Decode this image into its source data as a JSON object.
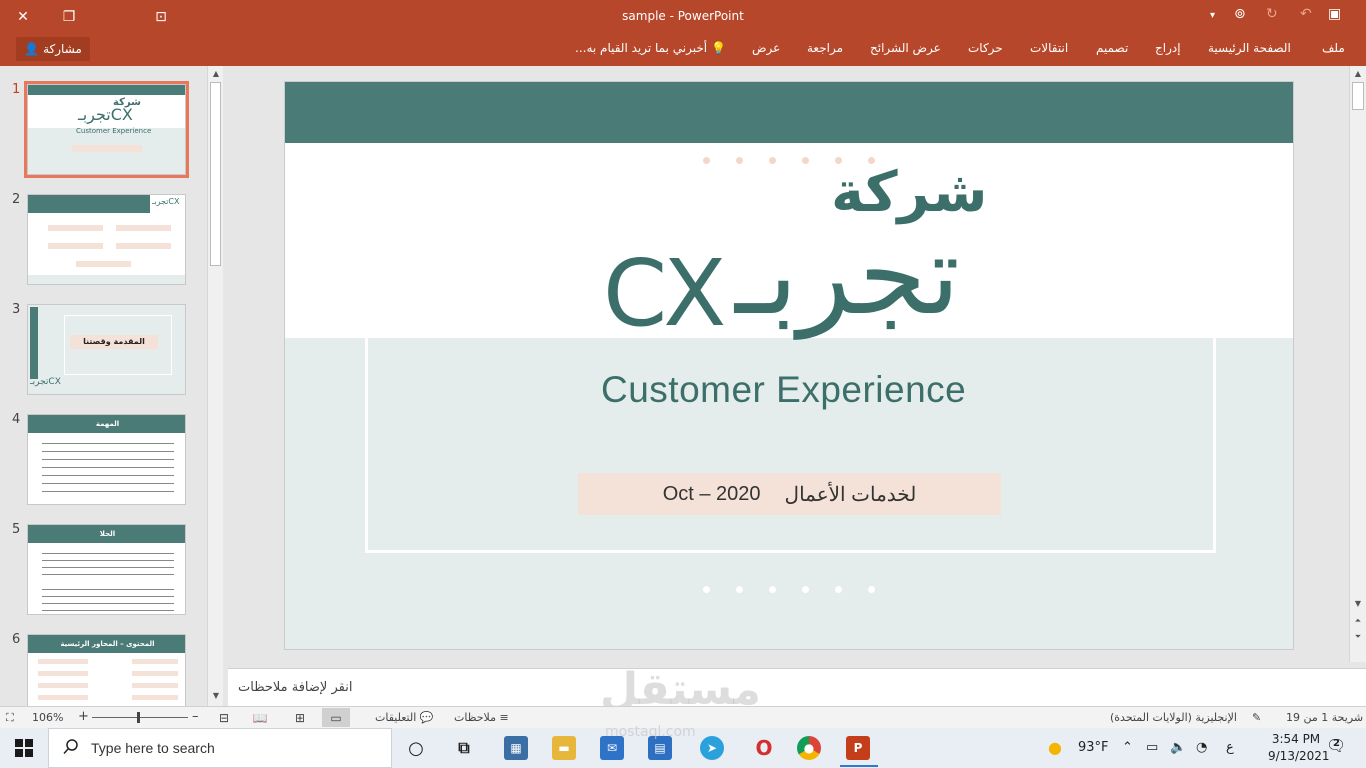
{
  "window": {
    "title": "sample - PowerPoint",
    "share_label": "مشاركة"
  },
  "ribbon": {
    "tabs": [
      "ملف",
      "الصفحة الرئيسية",
      "إدراج",
      "تصميم",
      "انتقالات",
      "حركات",
      "عرض الشرائح",
      "مراجعة",
      "عرض"
    ],
    "tell_me": "أخبرني بما تريد القيام به..."
  },
  "thumbnails": {
    "numbers": [
      "1",
      "2",
      "3",
      "4",
      "5",
      "6"
    ],
    "active_index": 1,
    "slide3_title": "المقدمة وقصتنا",
    "slide4_title": "المهمة",
    "slide5_title": "الحلا",
    "slide6_title": "المحتوى – المحاور الرئيسية",
    "slide2_logo": "تجربـCX"
  },
  "slide": {
    "company": "شركة",
    "brand_ar": "تجربـ",
    "brand_cx": "CX",
    "brand_en": "Customer Experience",
    "date_text": "Oct – 2020",
    "service_text": "لخدمات الأعمال",
    "colors": {
      "primary": "#4a7b76",
      "light_bg": "#e4ecec",
      "peach": "#f4e2d8",
      "dot_peach": "#f4d7c8"
    }
  },
  "notes": {
    "placeholder": "انقر لإضافة ملاحظات"
  },
  "watermark": {
    "text": "مستقل",
    "sub": "mostaql.com"
  },
  "statusbar": {
    "zoom": "106%",
    "comments_label": "التعليقات",
    "notes_label": "ملاحظات",
    "language": "الإنجليزية (الولايات المتحدة)",
    "slide_counter": "شريحة 1 من 19"
  },
  "taskbar": {
    "search_placeholder": "Type here to search",
    "weather": "93°F",
    "keyboard_lang": "ع",
    "time": "3:54 PM",
    "date": "9/13/2021",
    "notifications": "2"
  }
}
